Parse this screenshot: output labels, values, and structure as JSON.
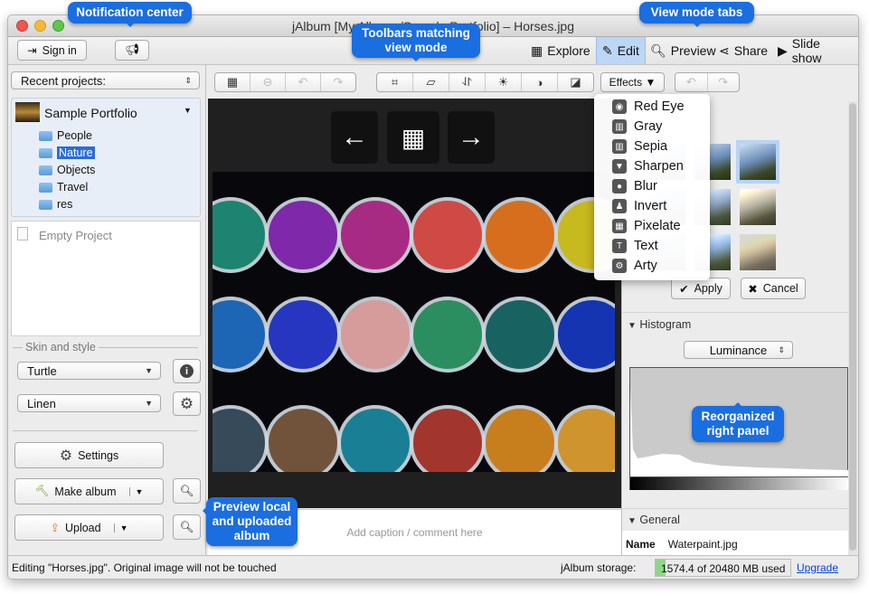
{
  "window": {
    "title": "jAlbum [My Albums/Sample Portfolio] – Horses.jpg"
  },
  "topbar": {
    "sign_in": "Sign in",
    "tabs": [
      {
        "label": "Explore",
        "icon": "grid-icon"
      },
      {
        "label": "Edit",
        "icon": "pencil-icon",
        "active": true
      },
      {
        "label": "Preview",
        "icon": "magnifier-icon"
      },
      {
        "label": "Share",
        "icon": "share-icon"
      },
      {
        "label": "Slide show",
        "icon": "play-icon"
      }
    ]
  },
  "left": {
    "recent_projects": "Recent projects:",
    "project": "Sample Portfolio",
    "folders": [
      "People",
      "Nature",
      "Objects",
      "Travel",
      "res"
    ],
    "selected_folder": "Nature",
    "empty_project": "Empty Project",
    "skin_section": "Skin and style",
    "skin": "Turtle",
    "style": "Linen",
    "settings": "Settings",
    "make_album": "Make album",
    "upload": "Upload"
  },
  "center": {
    "caption_placeholder": "Add caption / comment here",
    "effects": "Effects ▼"
  },
  "effects_menu": [
    {
      "label": "Red Eye",
      "icon": "eye-icon"
    },
    {
      "label": "Gray",
      "icon": "gray-icon"
    },
    {
      "label": "Sepia",
      "icon": "sepia-icon"
    },
    {
      "label": "Sharpen",
      "icon": "sharpen-icon"
    },
    {
      "label": "Blur",
      "icon": "drop-icon"
    },
    {
      "label": "Invert",
      "icon": "invert-icon"
    },
    {
      "label": "Pixelate",
      "icon": "pixelate-icon"
    },
    {
      "label": "Text",
      "icon": "text-icon"
    },
    {
      "label": "Arty",
      "icon": "gear-icon"
    }
  ],
  "right": {
    "apply": "Apply",
    "cancel": "Cancel",
    "histogram": "Histogram",
    "channel": "Luminance",
    "general": "General",
    "name_label": "Name",
    "name_value": "Waterpaint.jpg"
  },
  "status": {
    "message": "Editing \"Horses.jpg\". Original image will not be touched",
    "storage_label": "jAlbum storage:",
    "storage_value": "1574.4 of 20480 MB used",
    "storage_used_fraction": 0.077,
    "upgrade": "Upgrade"
  },
  "callouts": {
    "notification": "Notification center",
    "toolbars": "Toolbars matching view mode",
    "tabs": "View mode tabs",
    "right_panel": "Reorganized right panel",
    "preview": "Preview local and uploaded album"
  },
  "colors": {
    "accent": "#1a6ee0",
    "selection": "#bcd6f6"
  }
}
